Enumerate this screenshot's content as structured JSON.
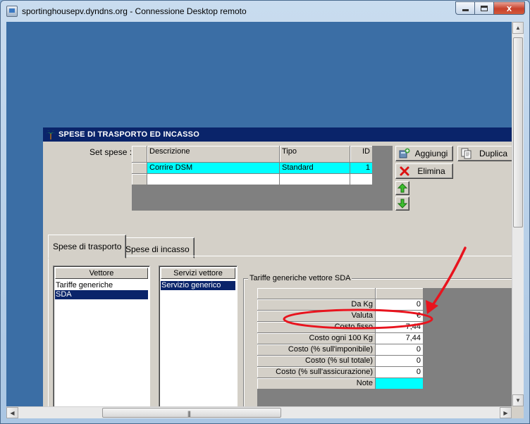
{
  "window": {
    "title": "sportinghousepv.dyndns.org - Connessione Desktop remoto",
    "close_glyph": "x"
  },
  "app": {
    "title": "SPESE DI TRASPORTO ED INCASSO",
    "set_label": "Set spese :",
    "grid": {
      "columns": [
        "Descrizione",
        "Tipo",
        "ID"
      ],
      "rows": [
        {
          "descrizione": "Corrire DSM",
          "tipo": "Standard",
          "id": "1"
        }
      ]
    },
    "buttons": {
      "add": "Aggiungi",
      "duplicate": "Duplica",
      "delete": "Elimina"
    },
    "tabs": [
      "Spese di trasporto",
      "Spese di incasso"
    ],
    "vettore": {
      "header": "Vettore",
      "items": [
        "Tariffe generiche",
        "SDA"
      ],
      "selected": 1
    },
    "servizi": {
      "header": "Servizi vettore",
      "items": [
        "Servizio generico"
      ],
      "selected": 0
    },
    "tariffe": {
      "title": "Tariffe generiche vettore SDA",
      "rows": [
        {
          "name": "Da Kg",
          "value": "0"
        },
        {
          "name": "Valuta",
          "value": "€"
        },
        {
          "name": "Costo fisso",
          "value": "7,44"
        },
        {
          "name": "Costo ogni 100 Kg",
          "value": "7,44"
        },
        {
          "name": "Costo (% sull'imponibile)",
          "value": "0"
        },
        {
          "name": "Costo (% sul totale)",
          "value": "0"
        },
        {
          "name": "Costo (% sull'assicurazione)",
          "value": "0"
        },
        {
          "name": "Note",
          "value": ""
        }
      ]
    }
  },
  "icons": {
    "app": "remote-desktop-icon",
    "inner": "palm-tree-icon",
    "add": "add-record-icon",
    "duplicate": "duplicate-icon",
    "delete": "red-x-icon",
    "up": "green-up-arrow-icon",
    "down": "green-down-arrow-icon"
  },
  "colors": {
    "desktop": "#3b6ea5",
    "inner_titlebar": "#0a246a",
    "selected_row": "#00ffff",
    "annotation": "#e8141e"
  }
}
